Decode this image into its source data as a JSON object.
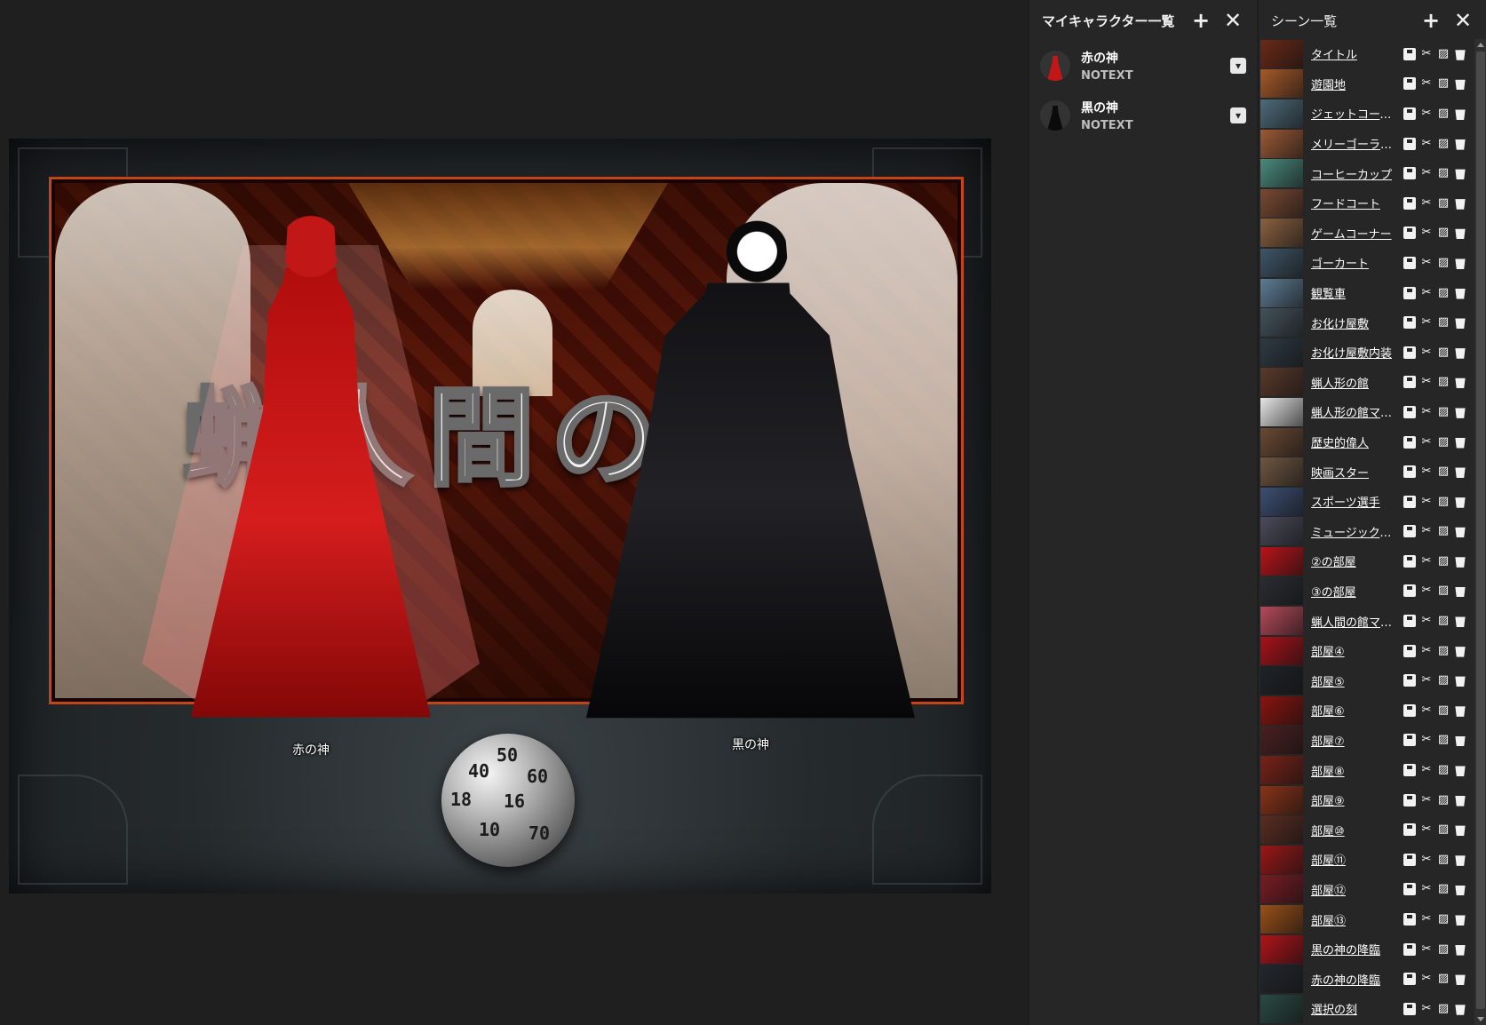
{
  "board": {
    "title_text": "蝋人間の",
    "pieces": [
      {
        "label": "赤の神"
      },
      {
        "label": "黒の神"
      }
    ],
    "dice_faces": [
      "50",
      "60",
      "18",
      "16",
      "10",
      "70",
      "40"
    ]
  },
  "character_panel": {
    "title": "マイキャラクター一覧",
    "add_icon": "+",
    "close_icon": "✕",
    "characters": [
      {
        "name": "赤の神",
        "note": "NOTEXT",
        "color": "#c21717"
      },
      {
        "name": "黒の神",
        "note": "NOTEXT",
        "color": "#0b0b0b"
      }
    ],
    "action_icon": "▾"
  },
  "scene_panel": {
    "title": "シーン一覧",
    "add_icon": "+",
    "close_icon": "✕",
    "scenes": [
      {
        "name": "タイトル",
        "thumb": "#6b2a18"
      },
      {
        "name": "遊園地",
        "thumb": "#a65a2a"
      },
      {
        "name": "ジェットコース…",
        "thumb": "#4f6b7a"
      },
      {
        "name": "メリーゴーランド",
        "thumb": "#9b5a36"
      },
      {
        "name": "コーヒーカップ",
        "thumb": "#4a8a7d"
      },
      {
        "name": "フードコート",
        "thumb": "#7a4a33"
      },
      {
        "name": "ゲームコーナー",
        "thumb": "#8a6140"
      },
      {
        "name": "ゴーカート",
        "thumb": "#3f5566"
      },
      {
        "name": "観覧車",
        "thumb": "#5e7c94"
      },
      {
        "name": "お化け屋敷",
        "thumb": "#44525b"
      },
      {
        "name": "お化け屋敷内装",
        "thumb": "#2e3b44"
      },
      {
        "name": "蝋人形の館",
        "thumb": "#5a3a2b"
      },
      {
        "name": "蝋人形の館マップ",
        "thumb": "#e6e6e6"
      },
      {
        "name": "歴史的偉人",
        "thumb": "#6a4a34"
      },
      {
        "name": "映画スター",
        "thumb": "#6f5642"
      },
      {
        "name": "スポーツ選手",
        "thumb": "#3c4f73"
      },
      {
        "name": "ミュージックス…",
        "thumb": "#4b4b5c"
      },
      {
        "name": "②の部屋",
        "thumb": "#b8141a"
      },
      {
        "name": "③の部屋",
        "thumb": "#2b2d33"
      },
      {
        "name": "蝋人間の館マップ",
        "thumb": "#b54a5a"
      },
      {
        "name": "部屋④",
        "thumb": "#a8121a"
      },
      {
        "name": "部屋⑤",
        "thumb": "#1f2329"
      },
      {
        "name": "部屋⑥",
        "thumb": "#8a1410"
      },
      {
        "name": "部屋⑦",
        "thumb": "#4a2020"
      },
      {
        "name": "部屋⑧",
        "thumb": "#7a2218"
      },
      {
        "name": "部屋⑨",
        "thumb": "#8a3318"
      },
      {
        "name": "部屋⑩",
        "thumb": "#5a2d22"
      },
      {
        "name": "部屋⑪",
        "thumb": "#9a1818"
      },
      {
        "name": "部屋⑫",
        "thumb": "#7a1c24"
      },
      {
        "name": "部屋⑬",
        "thumb": "#9a5018"
      },
      {
        "name": "黒の神の降臨",
        "thumb": "#b0141a"
      },
      {
        "name": "赤の神の降臨",
        "thumb": "#23272e"
      },
      {
        "name": "選択の刻",
        "thumb": "#2a4a44"
      }
    ]
  }
}
